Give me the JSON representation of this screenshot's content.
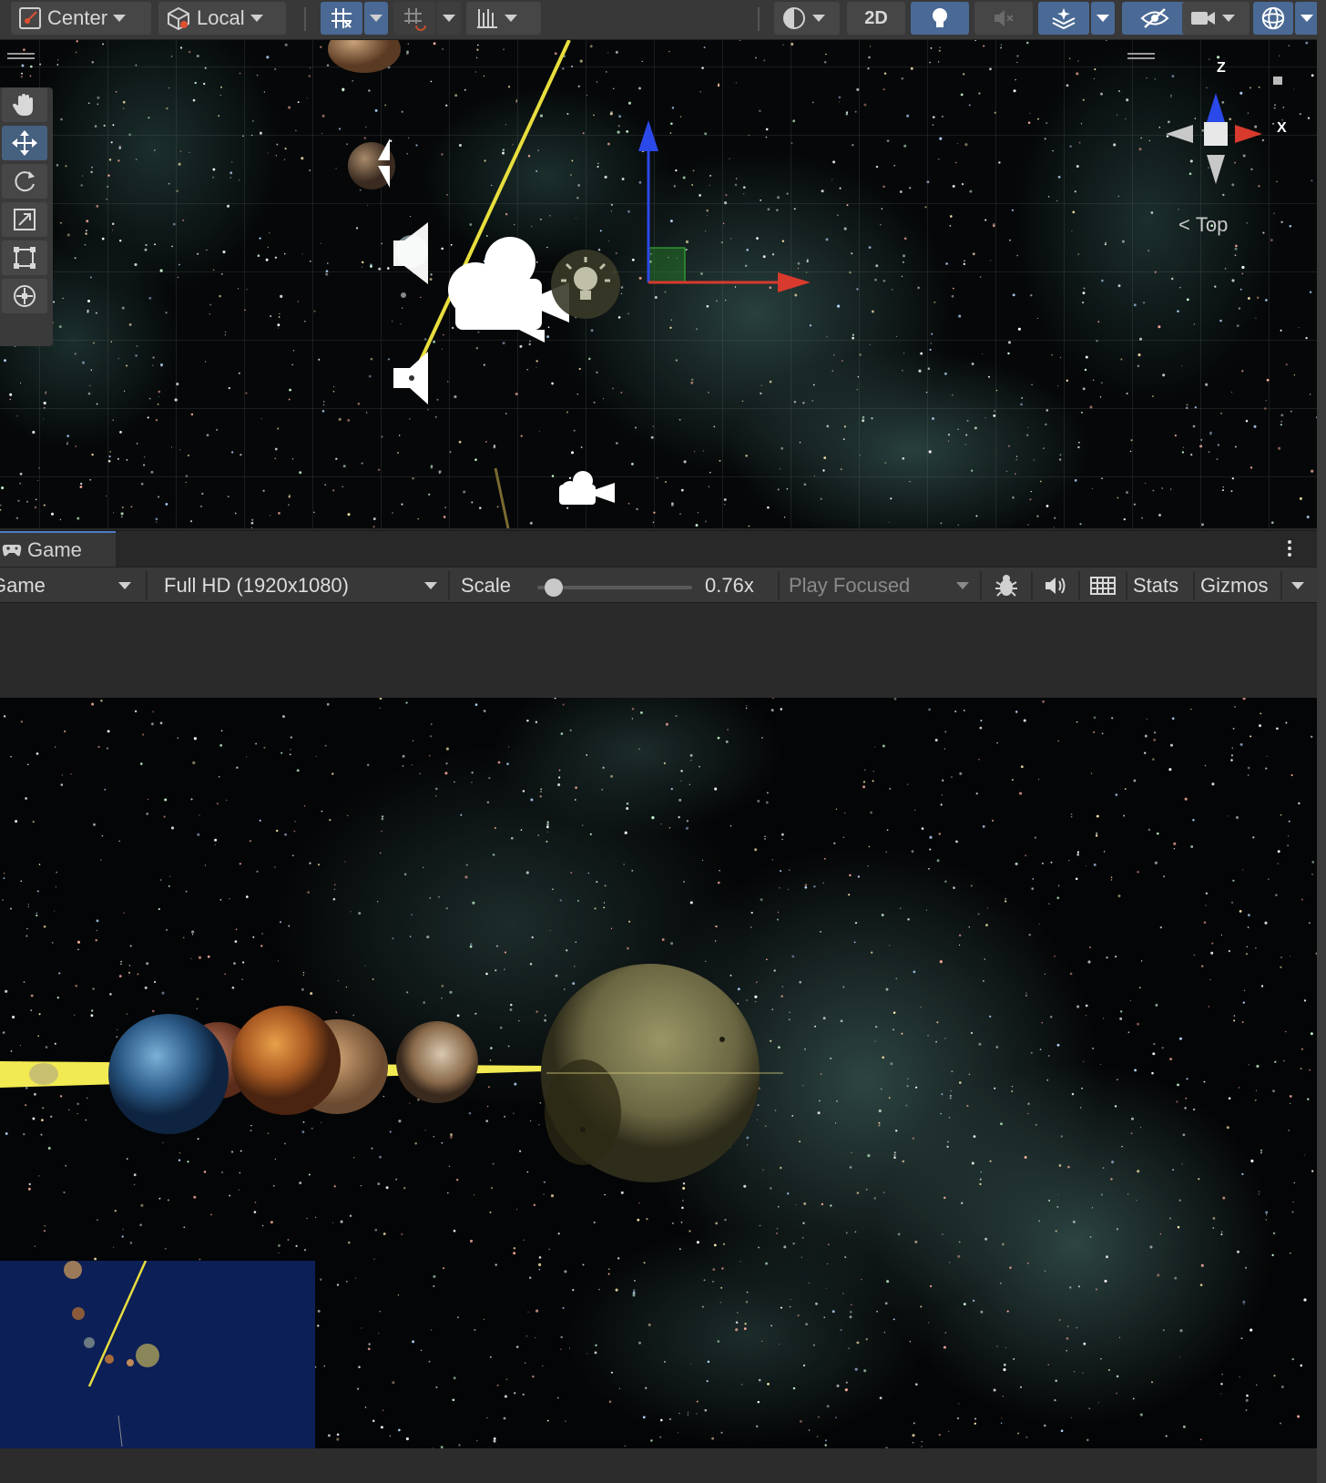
{
  "toolbar": {
    "pivot_label": "Center",
    "space_label": "Local",
    "mode_2d_label": "2D"
  },
  "scene_view": {
    "orientation_label": "Top",
    "gizmo_axes": {
      "z": "Z",
      "x": "X"
    }
  },
  "game_panel": {
    "tab_label": "Game",
    "display_label": "Game",
    "resolution_label": "Full HD (1920x1080)",
    "scale_label": "Scale",
    "scale_value": "0.76x",
    "scale_level": 0.05,
    "play_mode_label": "Play Focused",
    "stats_label": "Stats",
    "gizmos_label": "Gizmos"
  },
  "colors": {
    "toolbar_bg": "#383838",
    "button_active": "#4a6a95",
    "tab_accent": "#4a7dc8",
    "orbit_line": "#f2ea52",
    "axis_x": "#d83a2e",
    "axis_z": "#2b48e8",
    "minimap_bg": "#0c1f57"
  },
  "icons": [
    "hand-icon",
    "move-icon",
    "rotate-icon",
    "scale-icon",
    "rect-icon",
    "transform-icon",
    "camera-gizmo-icon",
    "light-gizmo-icon",
    "audio-gizmo-icon",
    "bug-icon",
    "speaker-icon",
    "grid-icon",
    "gamepad-icon",
    "kebab-menu-icon"
  ]
}
